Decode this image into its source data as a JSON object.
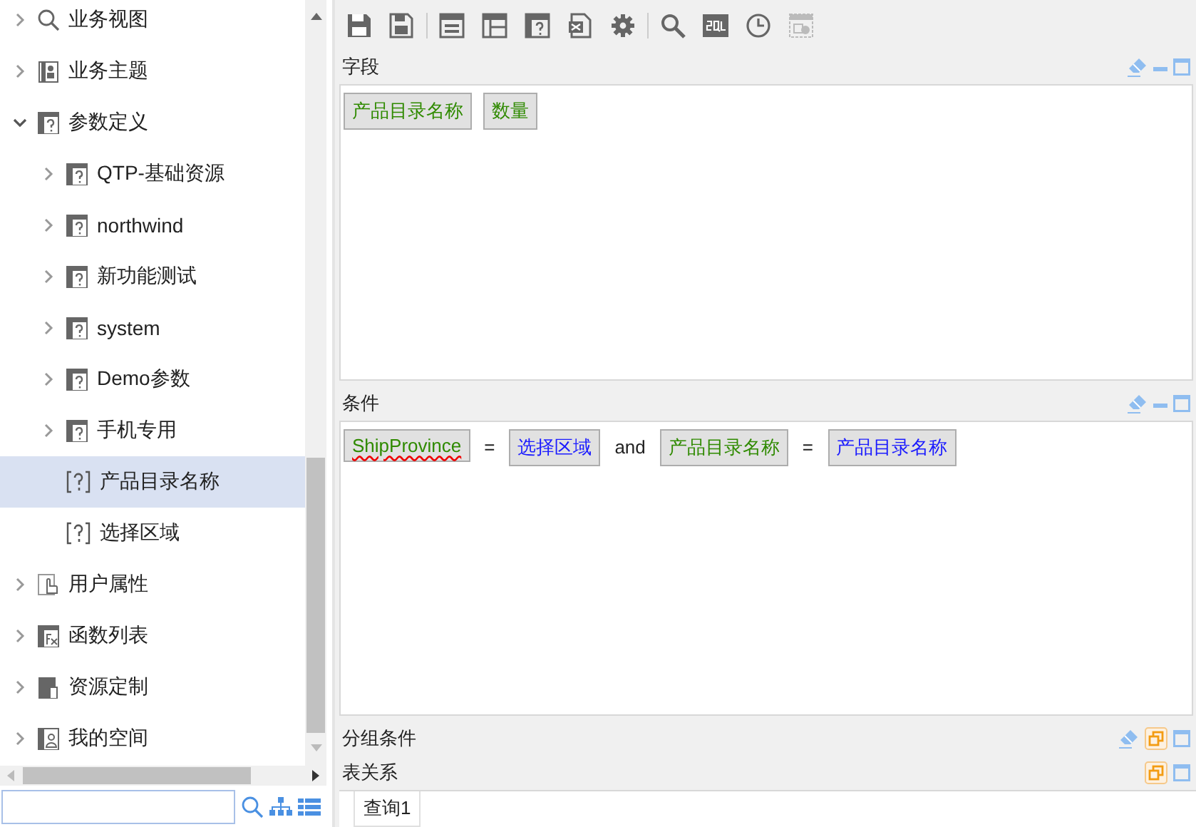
{
  "tree": [
    {
      "label": "业务视图",
      "expanded": false
    },
    {
      "label": "业务主题",
      "expanded": false
    },
    {
      "label": "参数定义",
      "expanded": true,
      "children": [
        {
          "label": "QTP-基础资源",
          "expanded": false
        },
        {
          "label": "northwind",
          "expanded": false
        },
        {
          "label": "新功能测试",
          "expanded": false
        },
        {
          "label": "system",
          "expanded": false
        },
        {
          "label": "Demo参数",
          "expanded": false
        },
        {
          "label": "手机专用",
          "expanded": false
        },
        {
          "label": "产品目录名称",
          "selected": true
        },
        {
          "label": "选择区域",
          "selected": false
        }
      ]
    },
    {
      "label": "用户属性",
      "expanded": false
    },
    {
      "label": "函数列表",
      "expanded": false
    },
    {
      "label": "资源定制",
      "expanded": false
    },
    {
      "label": "我的空间",
      "expanded": false
    }
  ],
  "sections": [
    {
      "title": "字段",
      "clearable": true,
      "collapsed": false,
      "tokens": [
        {
          "kind": "field",
          "text": "产品目录名称",
          "spell_error": false
        },
        {
          "kind": "field",
          "text": "数量",
          "spell_error": false
        }
      ]
    },
    {
      "title": "条件",
      "clearable": true,
      "collapsed": false,
      "tokens": [
        {
          "kind": "field",
          "text": "ShipProvince",
          "spell_error": true
        },
        {
          "kind": "operator",
          "text": "="
        },
        {
          "kind": "param",
          "text": "选择区域"
        },
        {
          "kind": "operator",
          "text": "and"
        },
        {
          "kind": "field",
          "text": "产品目录名称",
          "spell_error": false
        },
        {
          "kind": "operator",
          "text": "="
        },
        {
          "kind": "param",
          "text": "产品目录名称"
        }
      ]
    },
    {
      "title": "分组条件",
      "clearable": true,
      "collapsed": true
    },
    {
      "title": "表关系",
      "clearable": false,
      "collapsed": true
    }
  ],
  "query_tabs": [
    {
      "label": "查询1",
      "selected": true
    }
  ]
}
